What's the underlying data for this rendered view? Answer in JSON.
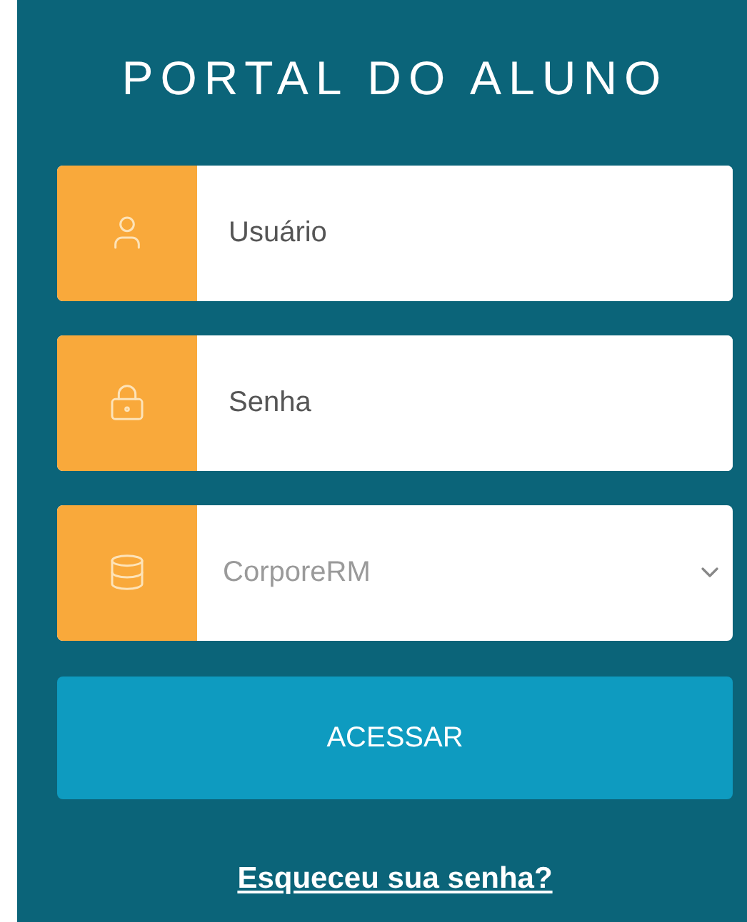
{
  "title": "PORTAL DO ALUNO",
  "fields": [
    {
      "kind": "text",
      "placeholder": "Usuário"
    },
    {
      "kind": "password",
      "placeholder": "Senha"
    },
    {
      "kind": "select",
      "value": "CorporeRM"
    }
  ],
  "button": "ACESSAR",
  "link": "Esqueceu sua senha?"
}
